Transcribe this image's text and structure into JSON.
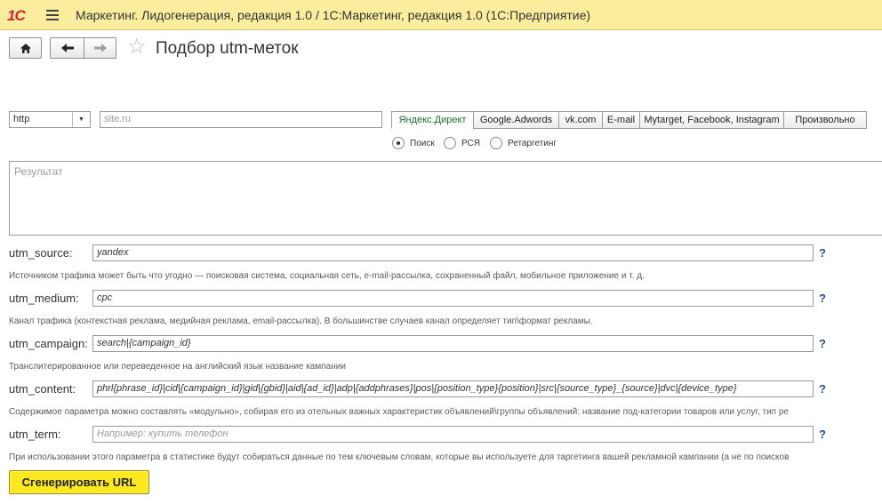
{
  "app": {
    "logo": "1С",
    "title": "Маркетинг. Лидогенерация, редакция 1.0 / 1С:Маркетинг, редакция 1.0   (1С:Предприятие)"
  },
  "page": {
    "title": "Подбор utm-меток"
  },
  "url": {
    "protocol": "http",
    "site_placeholder": "site.ru"
  },
  "tabs": [
    "Яндекс.Директ",
    "Google.Adwords",
    "vk.com",
    "E-mail",
    "Mytarget, Facebook, Instagram",
    "Произвольно"
  ],
  "radios": {
    "options": [
      "Поиск",
      "РСЯ",
      "Ретаргетинг"
    ],
    "selected": "Поиск"
  },
  "result": {
    "placeholder": "Результат"
  },
  "fields": {
    "source": {
      "label": "utm_source:",
      "value": "yandex",
      "hint": "Источником трафика может быть что угодно — поисковая система, социальная сеть, e-mail-рассылка, сохраненный файл, мобильное приложение и т. д."
    },
    "medium": {
      "label": "utm_medium:",
      "value": "cpc",
      "hint": "Канал трафика (контекстная реклама, медийная реклама, email-рассылка). В большинстве случаев канал определяет тип\\формат рекламы."
    },
    "campaign": {
      "label": "utm_campaign:",
      "value": "search|{campaign_id}",
      "hint": "Транслитерированное или переведенное на английский язык название кампании"
    },
    "content": {
      "label": "utm_content:",
      "value": "phrl{phrase_id}|cid|{campaign_id}|gid|{gbid}|aid|{ad_id}|adp|{addphrases}|pos|{position_type}{position}|src|{source_type}_{source}|dvc|{device_type}",
      "hint": "Содержимое параметра можно составлять «модульно», собирая его из отельных важных характеристик объявлений\\группы объявлений: название под-категории товаров или услуг, тип ре"
    },
    "term": {
      "label": "utm_term:",
      "placeholder": "Например: купить телефон",
      "hint": "При использовании этого параметра в статистике будут собираться данные по тем ключевым словам, которые вы используете для таргетинга вашей рекламной кампании (а не по поисков"
    }
  },
  "help_mark": "?",
  "buttons": {
    "generate": "Сгенерировать URL"
  },
  "icons": {
    "home": "home-icon",
    "back": "arrow-left-icon",
    "forward": "arrow-right-icon",
    "favorite": "star-icon",
    "menu": "hamburger-menu-icon",
    "dropdown": "chevron-down-icon"
  },
  "colors": {
    "titlebar": "#fbed9e",
    "accent_button": "#fbe81f",
    "active_tab_text": "#1d6f2e",
    "help": "#1f4e8c"
  }
}
